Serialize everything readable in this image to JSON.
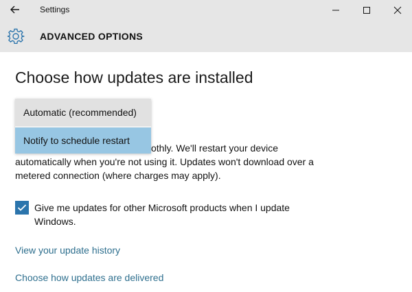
{
  "window": {
    "title": "Settings",
    "controls": {
      "minimize": "minimize-icon",
      "maximize": "maximize-icon",
      "close": "close-icon"
    }
  },
  "header": {
    "icon": "gear-icon",
    "title": "ADVANCED OPTIONS"
  },
  "main": {
    "section_title": "Choose how updates are installed",
    "dropdown": {
      "options": [
        "Automatic (recommended)",
        "Notify to schedule restart"
      ],
      "highlighted": "Notify to schedule restart"
    },
    "description": "othly. We'll restart your device automatically when you're not using it. Updates won't download over a metered connection (where charges may apply).",
    "checkbox": {
      "checked": true,
      "label": "Give me updates for other Microsoft products when I update Windows."
    },
    "links": {
      "update_history": "View your update history",
      "delivery": "Choose how updates are delivered"
    }
  },
  "colors": {
    "titlebar_bg": "#e6e6e6",
    "accent": "#2b74ac",
    "highlight": "#97c6e3",
    "link": "#2e6f8e"
  }
}
